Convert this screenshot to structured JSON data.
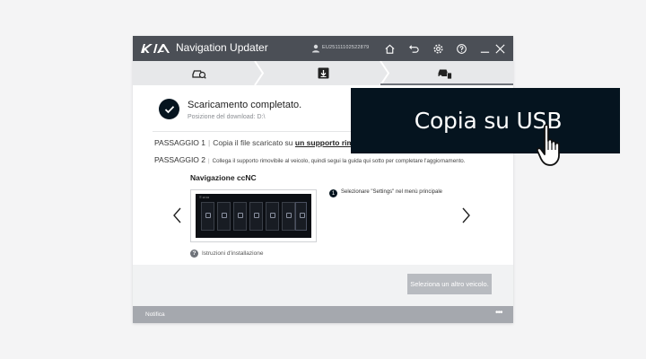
{
  "app": {
    "brand": "KIA",
    "title": "Navigation Updater",
    "user_id": "EU25111102522879"
  },
  "toolbar": {
    "icons": [
      "home-icon",
      "back-icon",
      "settings-icon",
      "help-icon",
      "minimize-icon",
      "close-icon"
    ]
  },
  "steps": [
    {
      "icon": "car-search-icon",
      "state": "done"
    },
    {
      "icon": "download-icon",
      "state": "done"
    },
    {
      "icon": "car-usb-icon",
      "state": "active"
    }
  ],
  "download": {
    "title": "Scaricamento completato.",
    "path_label": "Posizione del download: D:\\"
  },
  "instructions": {
    "step1_label": "PASSAGGIO 1",
    "step1_text": "Copia il file scaricato su",
    "step1_link": "un supporto rim",
    "step2_label": "PASSAGGIO 2",
    "step2_text": "Collega il supporto rimovibile al veicolo, quindi segui la guida qui sotto per completare l'aggiornamento."
  },
  "guide": {
    "title": "Navigazione ccNC",
    "screen_header": "☰ 10:34 ",
    "step_number": "1",
    "step_text": "Selezionare \"Settings\" nel menù principale",
    "help_text": "Istruzioni d'installazione"
  },
  "actions": {
    "other_vehicle": "Seleziona un altro veicolo."
  },
  "status": {
    "notify": "Notifica",
    "more": "•••"
  },
  "callout": {
    "text": "Copia su USB"
  },
  "colors": {
    "titlebar": "#4b4f56",
    "dark": "#05141f",
    "status": "#a5a8ae",
    "button_disabled": "#b8bbc0"
  }
}
